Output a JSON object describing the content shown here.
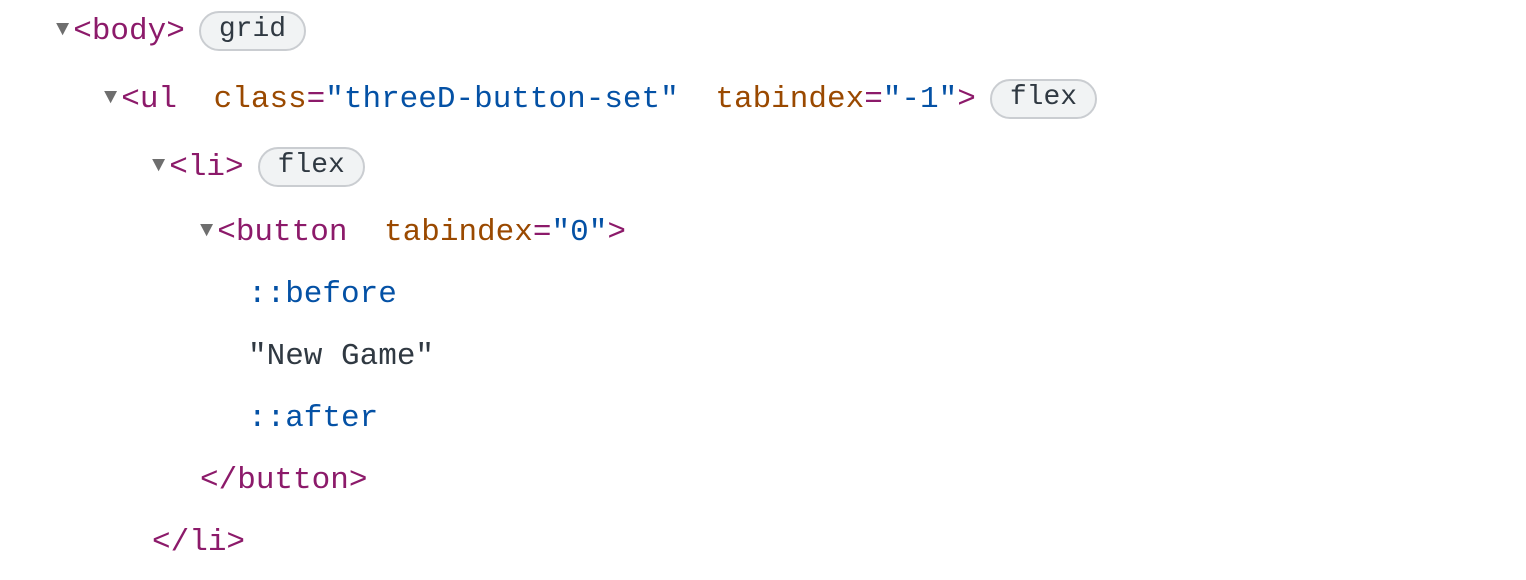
{
  "tree": {
    "body": {
      "tag_open": "body",
      "badge": "grid"
    },
    "ul": {
      "tag_open": "ul",
      "attrs": {
        "class_name": "class",
        "class_value": "threeD-button-set",
        "tabindex_name": "tabindex",
        "tabindex_value": "-1"
      },
      "badge": "flex"
    },
    "li": {
      "tag_open": "li",
      "tag_close": "/li",
      "badge": "flex"
    },
    "button": {
      "tag_open": "button",
      "tag_close": "/button",
      "attrs": {
        "tabindex_name": "tabindex",
        "tabindex_value": "0"
      }
    },
    "pseudo_before": "::before",
    "text_node": "\"New Game\"",
    "pseudo_after": "::after"
  }
}
